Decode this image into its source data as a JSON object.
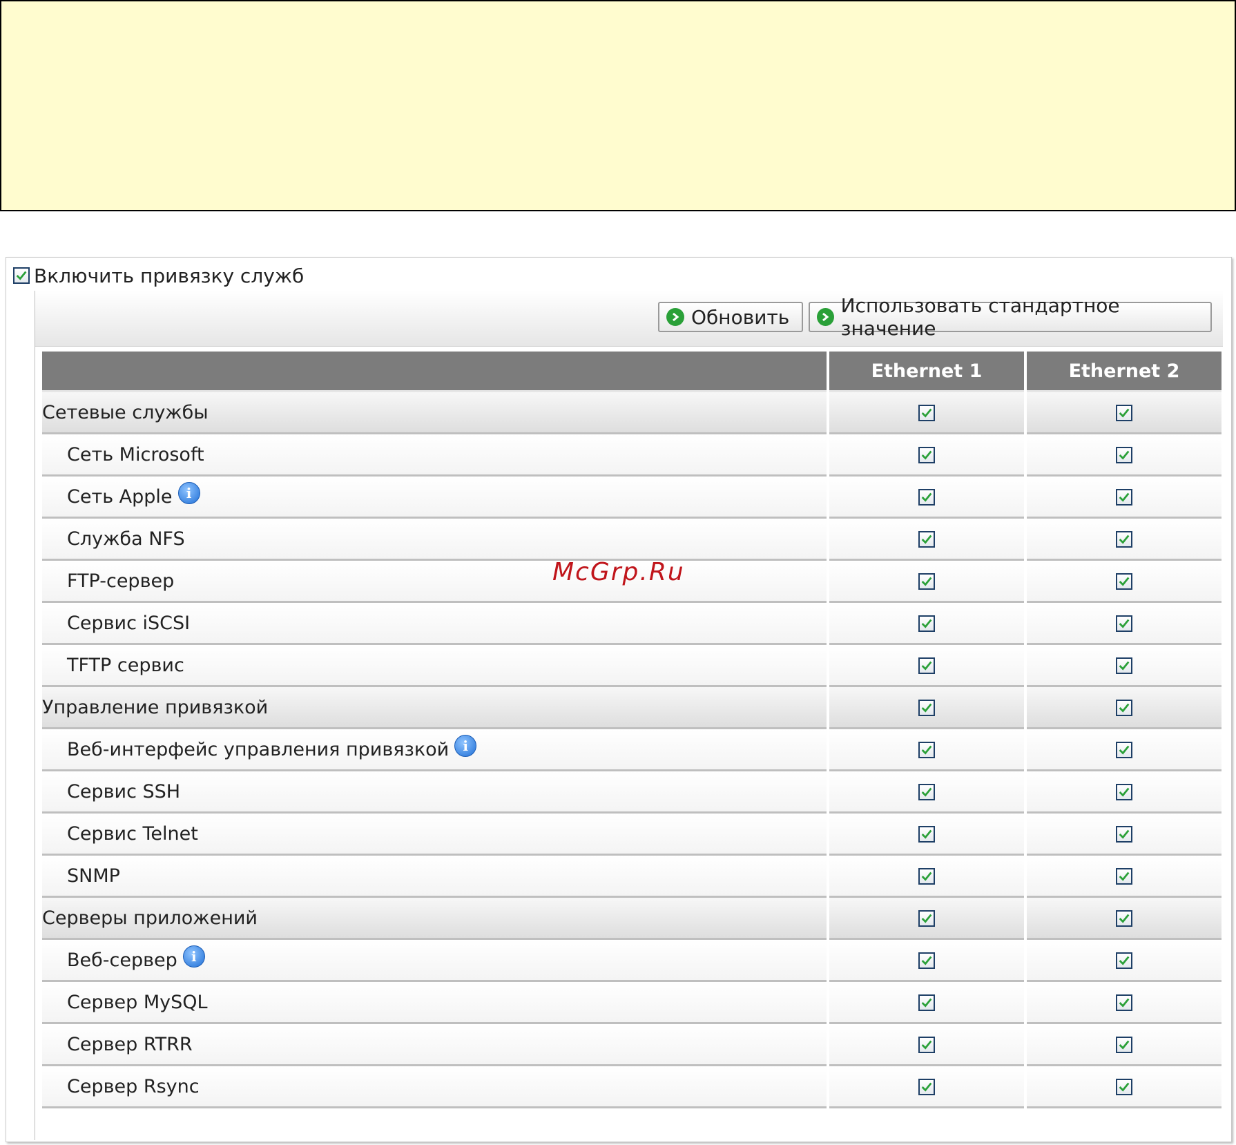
{
  "enable_binding": {
    "label": "Включить привязку служб",
    "checked": true
  },
  "toolbar": {
    "refresh_label": "Обновить",
    "default_label": "Использовать стандартное значение"
  },
  "table": {
    "columns": [
      "",
      "Ethernet 1",
      "Ethernet 2"
    ],
    "rows": [
      {
        "type": "group",
        "label": "Сетевые службы",
        "info": false,
        "eth1": true,
        "eth2": true
      },
      {
        "type": "item",
        "label": "Сеть Microsoft",
        "info": false,
        "eth1": true,
        "eth2": true
      },
      {
        "type": "item",
        "label": "Сеть Apple",
        "info": true,
        "eth1": true,
        "eth2": true
      },
      {
        "type": "item",
        "label": "Служба NFS",
        "info": false,
        "eth1": true,
        "eth2": true
      },
      {
        "type": "item",
        "label": "FTP-сервер",
        "info": false,
        "eth1": true,
        "eth2": true
      },
      {
        "type": "item",
        "label": "Сервис iSCSI",
        "info": false,
        "eth1": true,
        "eth2": true
      },
      {
        "type": "item",
        "label": "TFTP сервис",
        "info": false,
        "eth1": true,
        "eth2": true
      },
      {
        "type": "group",
        "label": "Управление привязкой",
        "info": false,
        "eth1": true,
        "eth2": true
      },
      {
        "type": "item",
        "label": "Веб-интерфейс управления привязкой",
        "info": true,
        "eth1": true,
        "eth2": true
      },
      {
        "type": "item",
        "label": "Сервис SSH",
        "info": false,
        "eth1": true,
        "eth2": true
      },
      {
        "type": "item",
        "label": "Сервис Telnet",
        "info": false,
        "eth1": true,
        "eth2": true
      },
      {
        "type": "item",
        "label": "SNMP",
        "info": false,
        "eth1": true,
        "eth2": true
      },
      {
        "type": "group",
        "label": "Серверы приложений",
        "info": false,
        "eth1": true,
        "eth2": true
      },
      {
        "type": "item",
        "label": "Веб-сервер",
        "info": true,
        "eth1": true,
        "eth2": true
      },
      {
        "type": "item",
        "label": "Сервер MySQL",
        "info": false,
        "eth1": true,
        "eth2": true
      },
      {
        "type": "item",
        "label": "Сервер RTRR",
        "info": false,
        "eth1": true,
        "eth2": true
      },
      {
        "type": "item",
        "label": "Сервер Rsync",
        "info": false,
        "eth1": true,
        "eth2": true
      }
    ]
  },
  "info_glyph": "i",
  "watermark": "McGrp.Ru",
  "colors": {
    "note_bg": "#fffccf",
    "header_bg": "#7c7c7c",
    "check_green": "#2aa038",
    "watermark": "#c0151b"
  }
}
